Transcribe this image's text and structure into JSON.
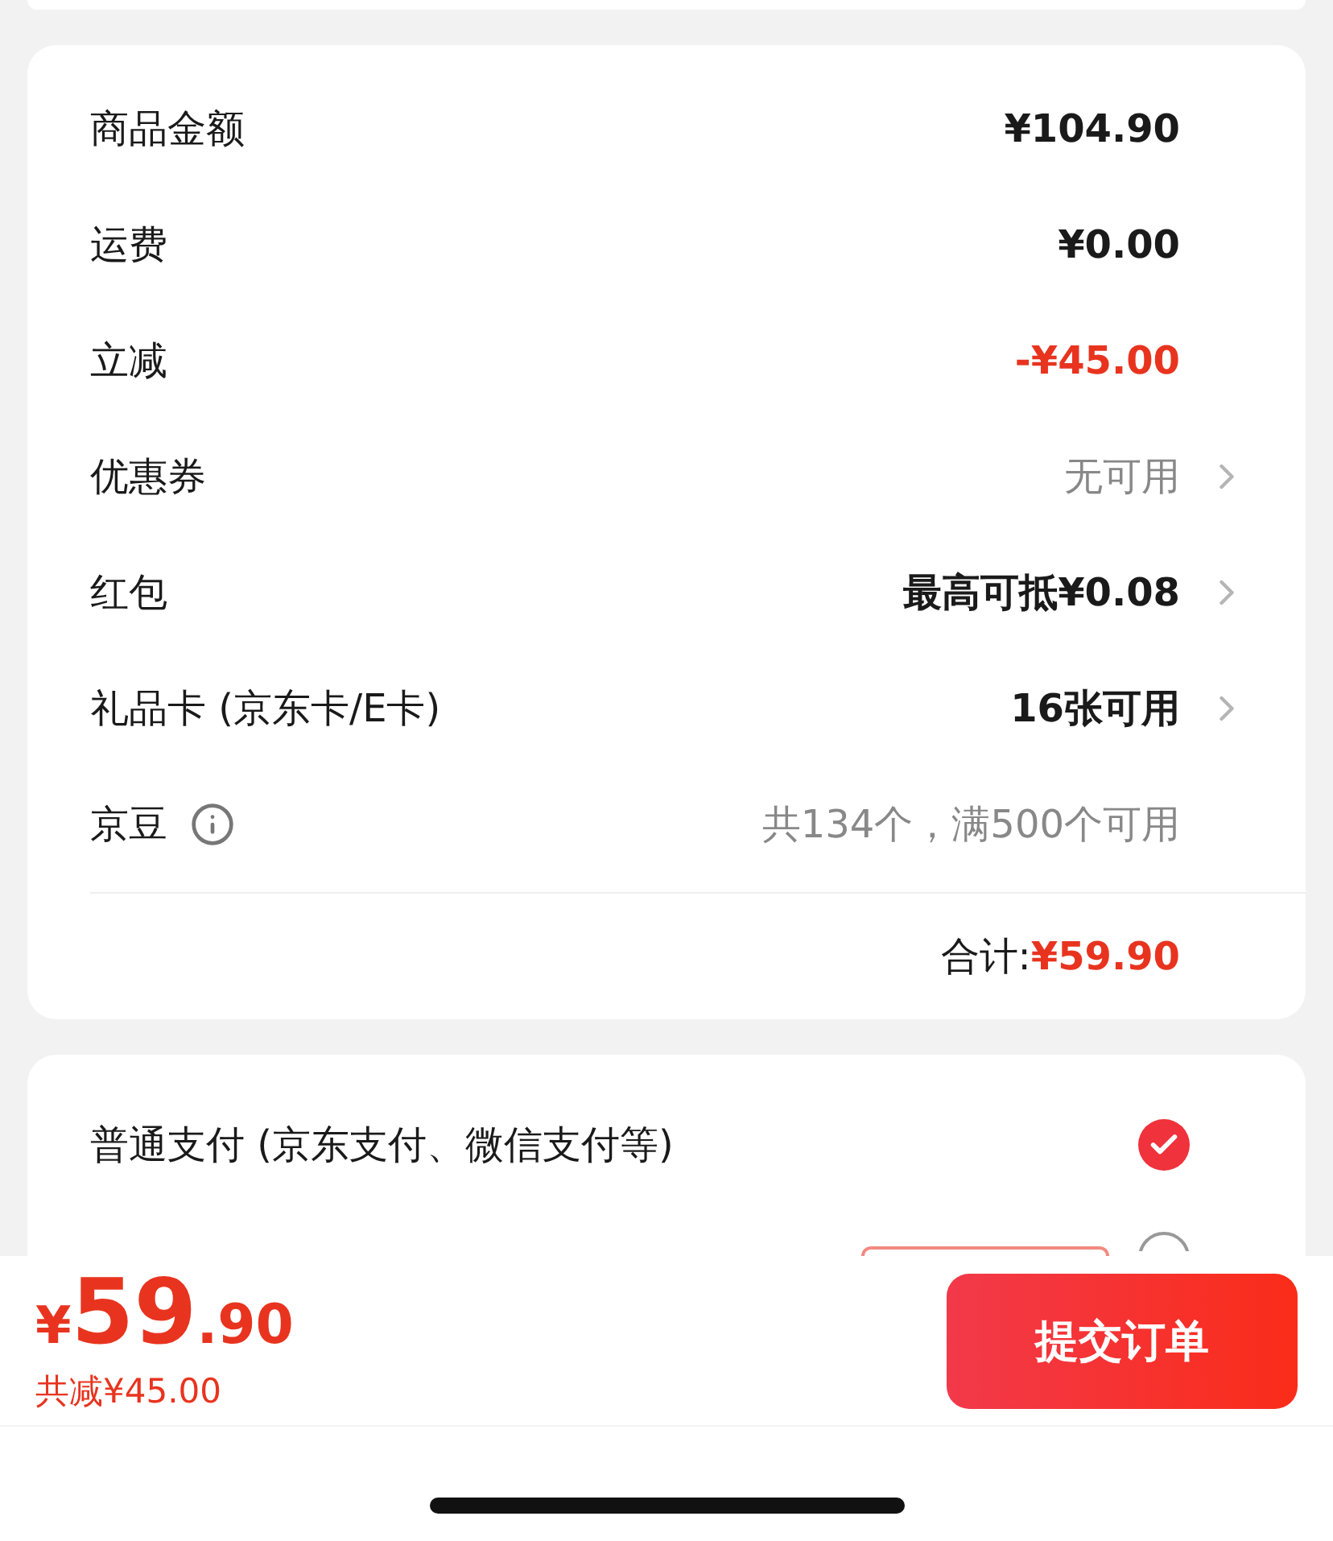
{
  "summary": {
    "rows": [
      {
        "label": "商品金额",
        "value": "¥104.90",
        "color": "#1a1a1a",
        "arrow": false,
        "info": false
      },
      {
        "label": "运费",
        "value": "¥0.00",
        "color": "#1a1a1a",
        "arrow": false,
        "info": false
      },
      {
        "label": "立减",
        "value": "-¥45.00",
        "color": "#e8341f",
        "arrow": false,
        "info": false
      },
      {
        "label": "优惠券",
        "value": "无可用",
        "color": "#888888",
        "arrow": true,
        "info": false
      },
      {
        "label": "红包",
        "value": "最高可抵¥0.08",
        "color": "#1a1a1a",
        "arrow": true,
        "info": false
      },
      {
        "label": "礼品卡 (京东卡/E卡)",
        "value": "16张可用",
        "color": "#1a1a1a",
        "arrow": true,
        "info": false
      },
      {
        "label": "京豆",
        "value": "共134个，满500个可用",
        "color": "#888888",
        "arrow": false,
        "info": true
      }
    ],
    "total": {
      "label": "合计:",
      "value": "¥59.90"
    }
  },
  "payment": {
    "options": [
      {
        "label": "普通支付 (京东支付、微信支付等)",
        "selected": true
      },
      {
        "selected": false
      }
    ]
  },
  "bottom_bar": {
    "currency": "¥",
    "price_integer": "59",
    "price_decimal": ".90",
    "saving": "共减¥45.00",
    "submit": "提交订单"
  }
}
